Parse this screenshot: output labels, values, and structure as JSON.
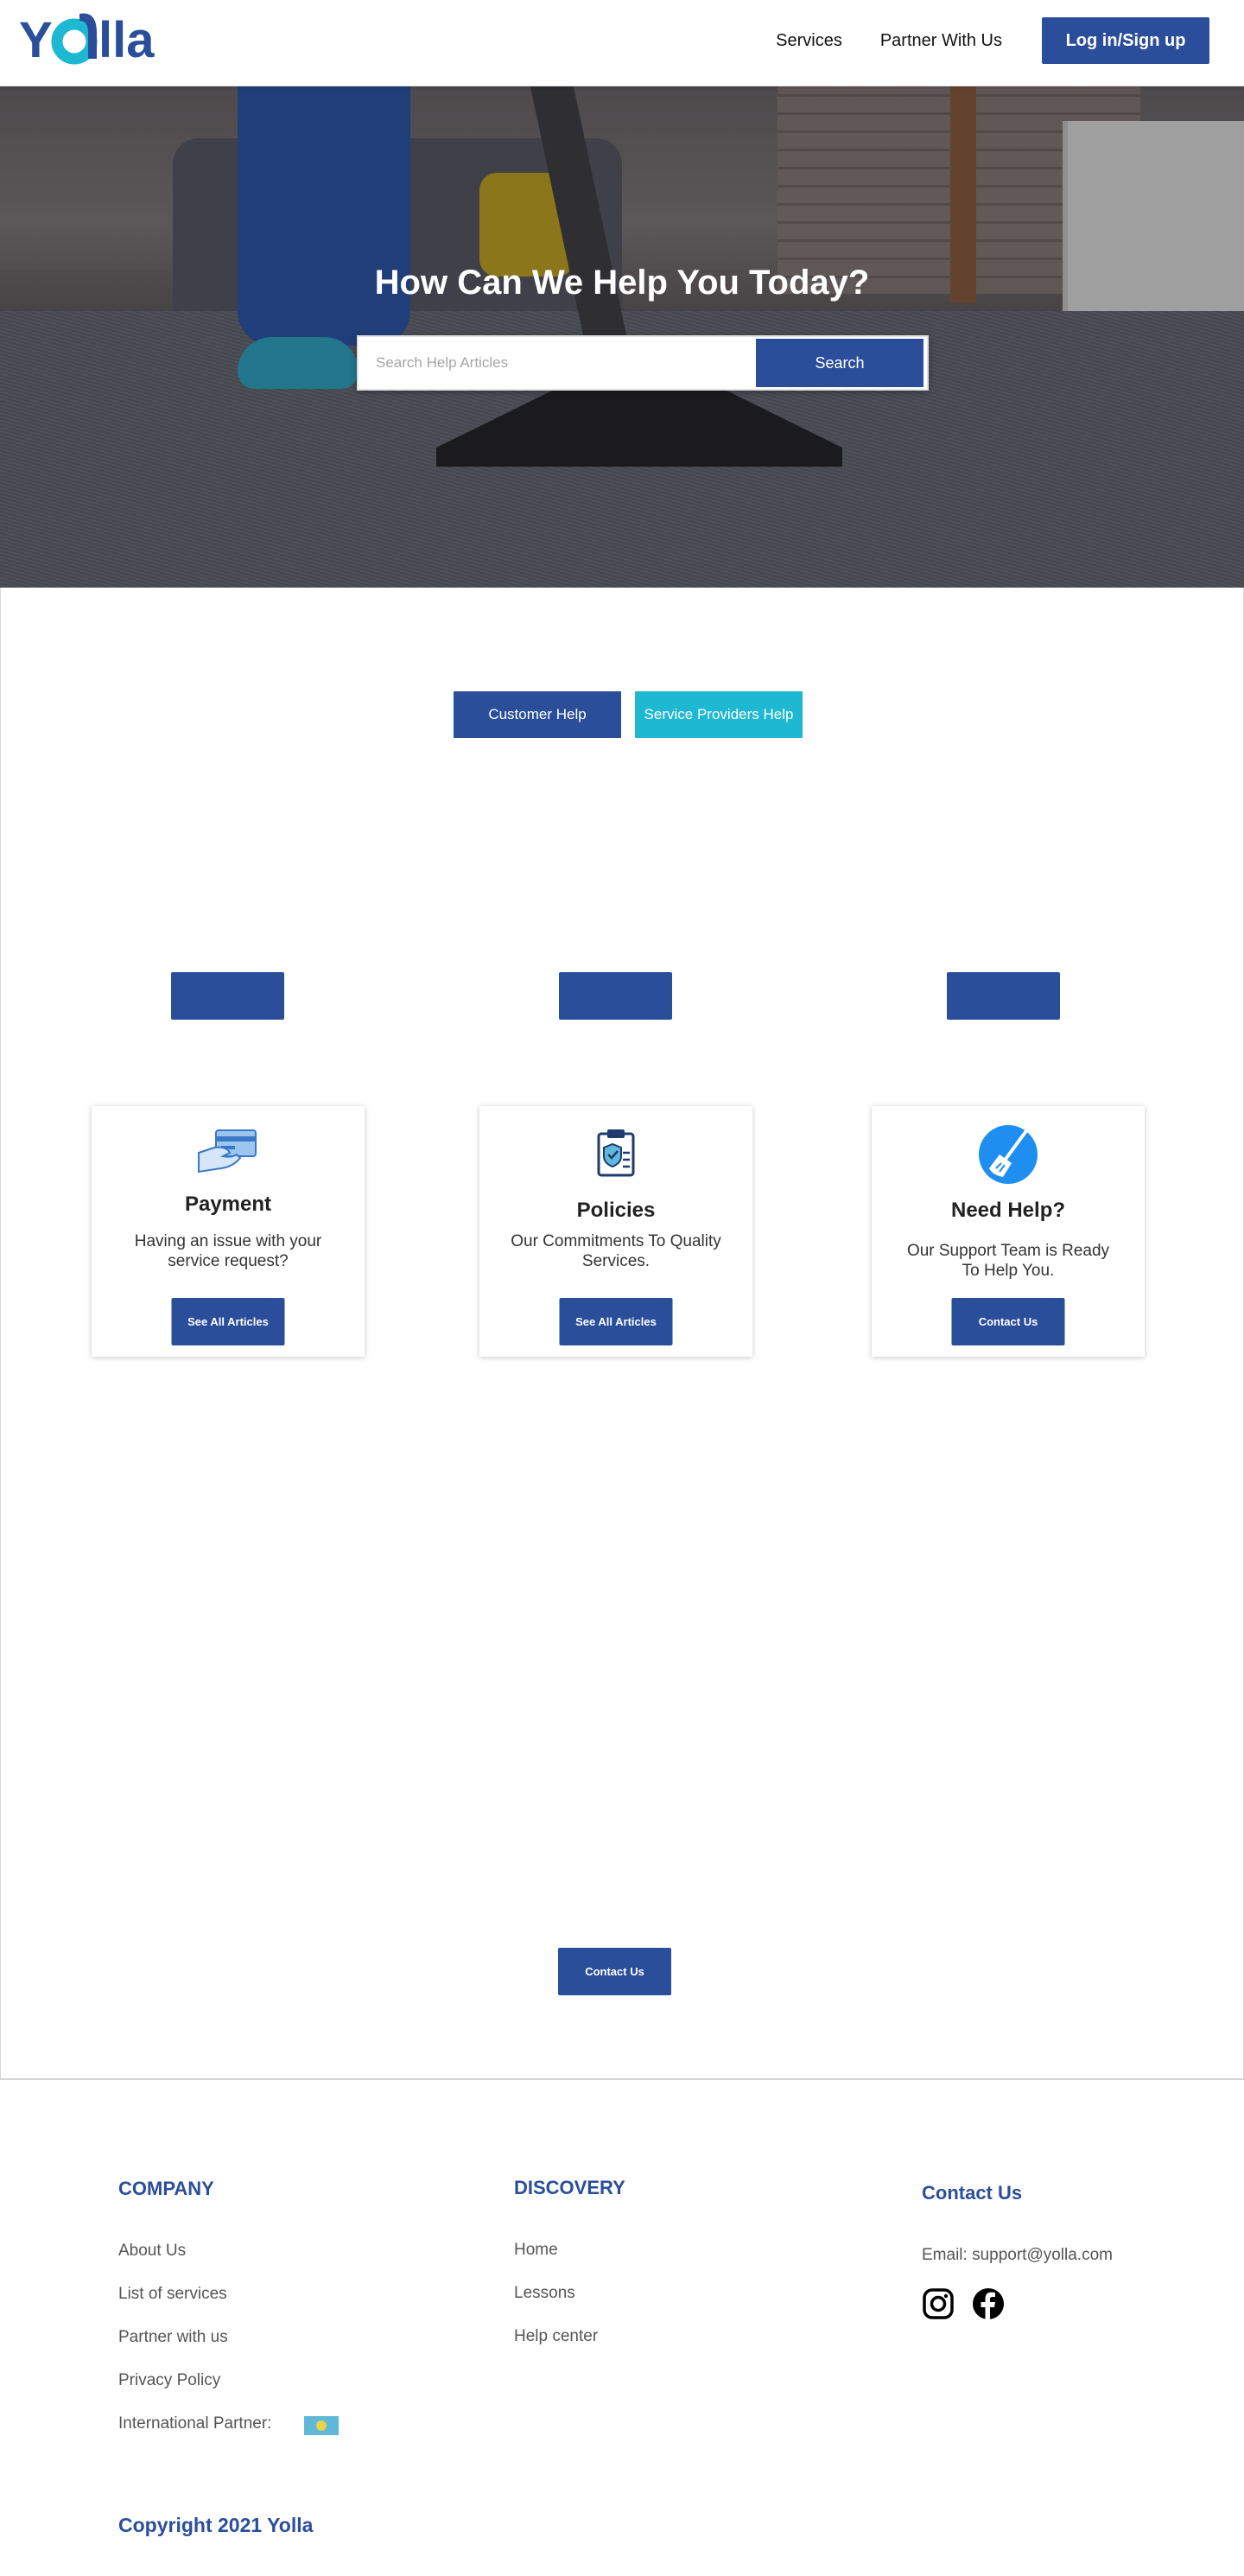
{
  "header": {
    "logo_text": "Yolla",
    "nav": {
      "services": "Services",
      "partner": "Partner With Us",
      "login": "Log in/Sign up"
    }
  },
  "hero": {
    "title": "How Can We Help You Today?",
    "search_placeholder": "Search Help Articles",
    "search_button": "Search"
  },
  "help_tabs": {
    "customer": "Customer Help",
    "provider": "Service Providers Help"
  },
  "cards": [
    {
      "icon": "credit-card-hand-icon",
      "title": "Payment",
      "text": "Having an issue with your service request?",
      "button": "See All Articles"
    },
    {
      "icon": "clipboard-shield-icon",
      "title": "Policies",
      "text": "Our Commitments To Quality Services.",
      "button": "See All Articles"
    },
    {
      "icon": "broom-icon",
      "title": "Need Help?",
      "text": "Our Support Team is Ready To Help You.",
      "button": "Contact Us"
    }
  ],
  "contact_button": "Contact Us",
  "footer": {
    "company": {
      "heading": "COMPANY",
      "links": [
        "About Us",
        "List of services",
        "Partner with us",
        "Privacy Policy",
        "International Partner:"
      ]
    },
    "discovery": {
      "heading": "DISCOVERY",
      "links": [
        "Home",
        "Lessons",
        "Help center"
      ]
    },
    "contact": {
      "heading": "Contact Us",
      "email": "Email: support@yolla.com",
      "social": [
        "instagram-icon",
        "facebook-icon"
      ]
    },
    "copyright": "Copyright 2021 Yolla"
  },
  "colors": {
    "primary": "#2b4e9b",
    "accent": "#1fb8d3"
  }
}
